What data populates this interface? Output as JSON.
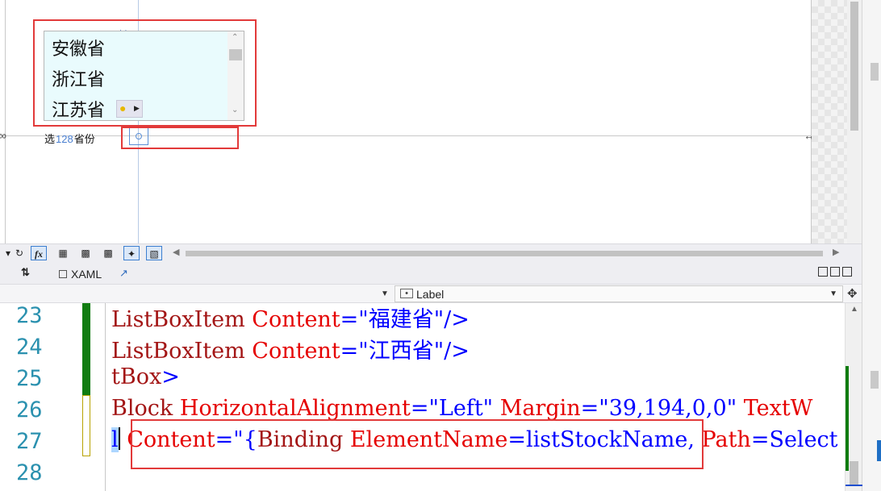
{
  "designer": {
    "listbox_items": [
      "安徽省",
      "浙江省",
      "江苏省"
    ],
    "guide_vertical_value": "196",
    "guide_horizontal_value": "128",
    "label_text_before": "选",
    "label_text_after": "省份"
  },
  "toolbar": {
    "fx_label": "fx"
  },
  "tabs": {
    "xaml_label": "XAML"
  },
  "navbar": {
    "element_selector": "Label"
  },
  "editor": {
    "line_numbers": [
      "23",
      "24",
      "25",
      "26",
      "27",
      "28"
    ],
    "line23": {
      "tag": "ListBoxItem",
      "attr": "Content",
      "eq": "=",
      "value": "\"福建省\"",
      "end": "/>"
    },
    "line24": {
      "tag": "ListBoxItem",
      "attr": "Content",
      "eq": "=",
      "value": "\"江西省\"",
      "end": "/>"
    },
    "line25": {
      "tag": "tBox",
      "end": ">"
    },
    "line26": {
      "tag": "Block",
      "attr1": "HorizontalAlignment",
      "val1": "\"Left\"",
      "attr2": "Margin",
      "val2": "\"39,194,0,0\"",
      "attr3": "TextW"
    },
    "line27": {
      "sel": "l",
      "attr": "Content",
      "eq": "=",
      "val": "\"{",
      "binding": "Binding",
      "sub1": "ElementName",
      "sub1val": "listStockName,",
      "sub2": "Path",
      "sub2val": "Select"
    }
  },
  "colors": {
    "highlight": "#e23a3a",
    "linenum": "#2b91af",
    "xml_tag": "#a31515",
    "xml_attr": "#e50000",
    "xml_value": "#0000ff",
    "gutter_changed": "#107c10"
  }
}
